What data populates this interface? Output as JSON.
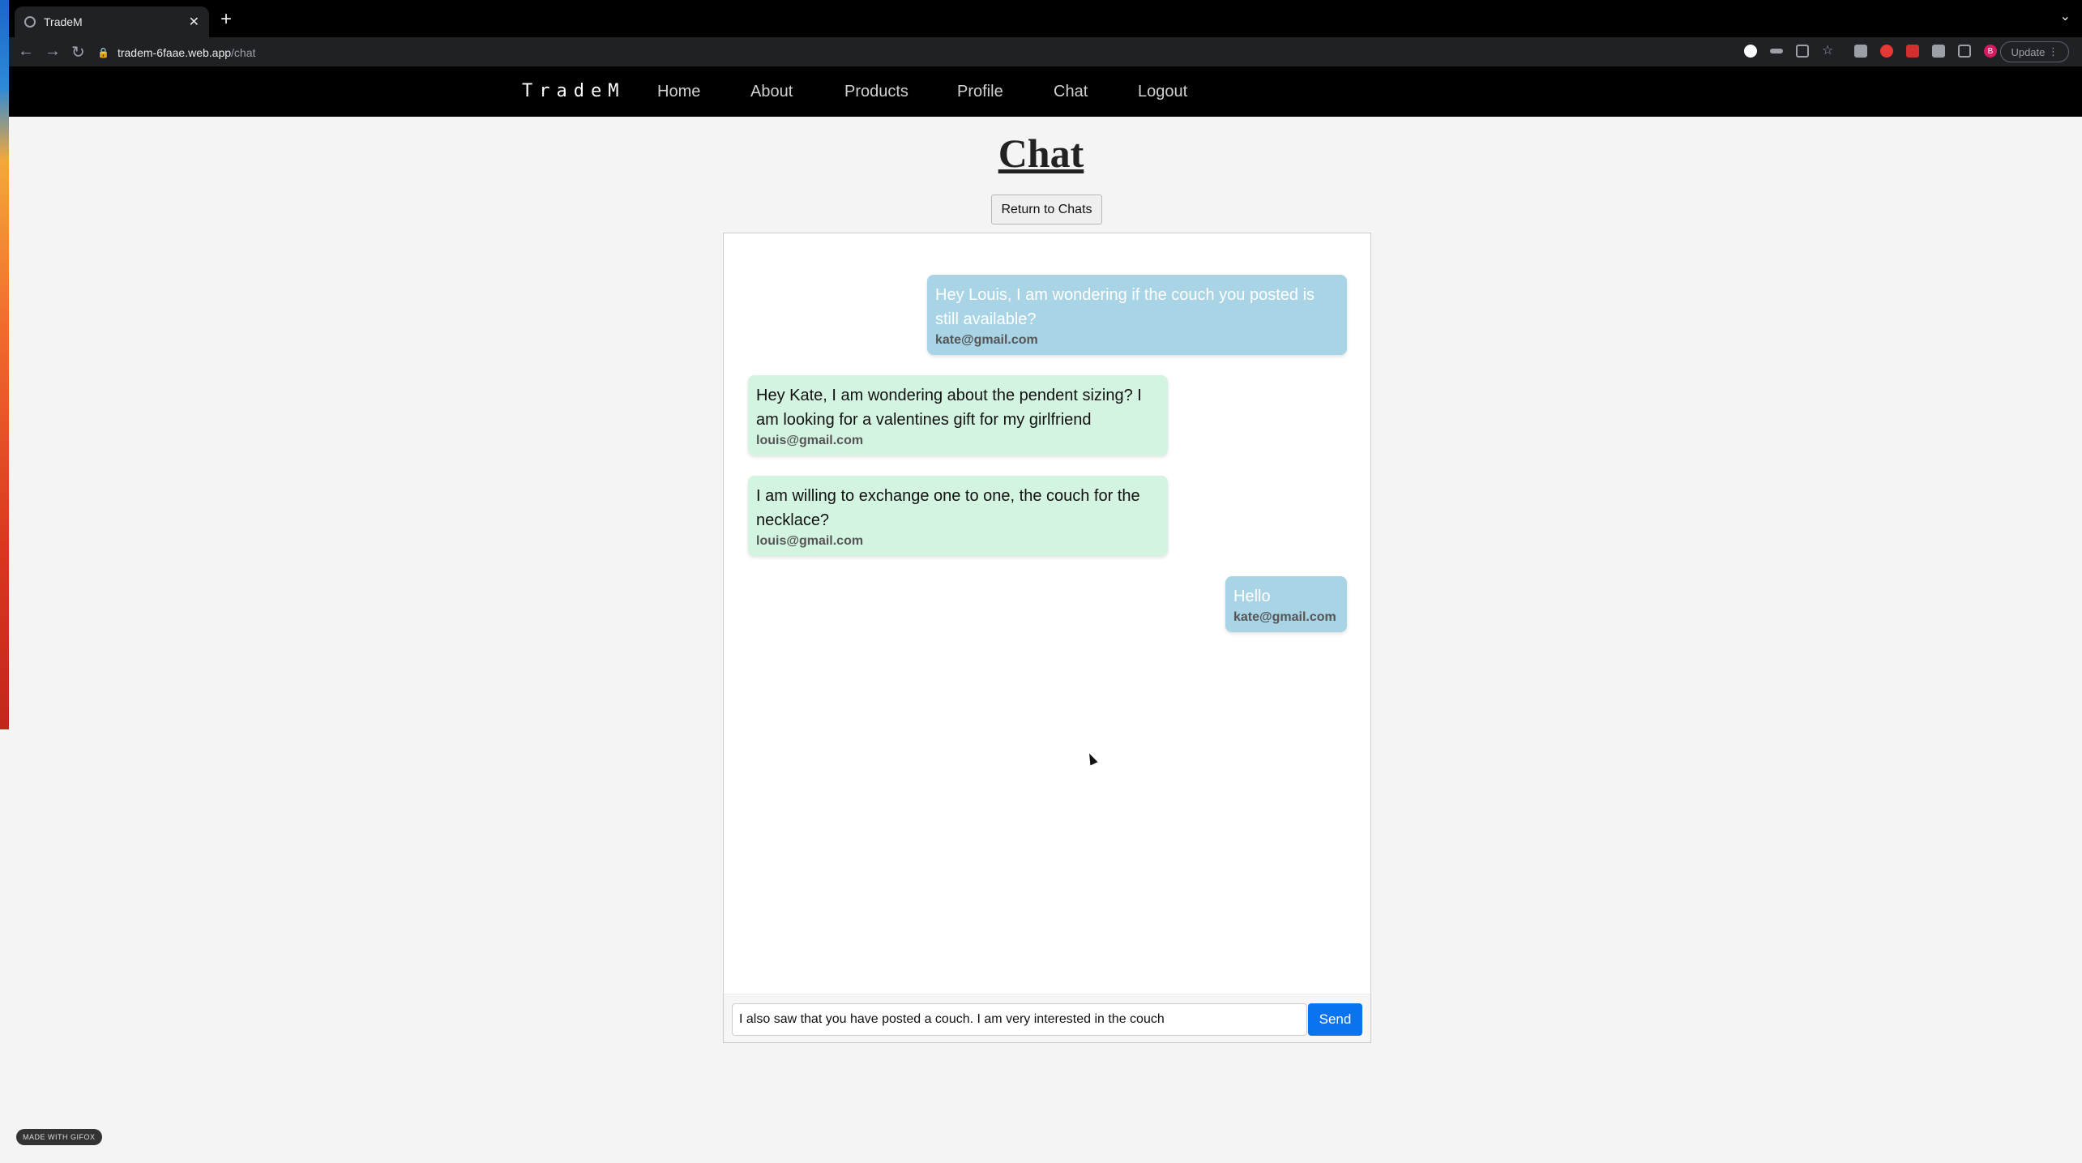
{
  "browser": {
    "tab_title": "TradeM",
    "url_host": "tradem-6faae.web.app",
    "url_path": "/chat",
    "update_label": "Update",
    "profile_initial": "B"
  },
  "site": {
    "brand": "TradeM",
    "nav": [
      "Home",
      "About",
      "Products",
      "Profile",
      "Chat",
      "Logout"
    ]
  },
  "page": {
    "title": "Chat",
    "return_button": "Return to Chats"
  },
  "messages": [
    {
      "text": "Hey Louis, I am wondering if the couch you posted is still available?",
      "sender": "kate@gmail.com",
      "side": "sent"
    },
    {
      "text": "Hey Kate, I am wondering about the pendent sizing? I am looking for a valentines gift for my girlfriend",
      "sender": "louis@gmail.com",
      "side": "recv"
    },
    {
      "text": "I am willing to exchange one to one, the couch for the necklace?",
      "sender": "louis@gmail.com",
      "side": "recv"
    },
    {
      "text": "Hello",
      "sender": "kate@gmail.com",
      "side": "sent"
    }
  ],
  "composer": {
    "value": "I also saw that you have posted a couch. I am very interested in the couch",
    "send_label": "Send"
  },
  "footer_badge": "MADE WITH GIFOX"
}
